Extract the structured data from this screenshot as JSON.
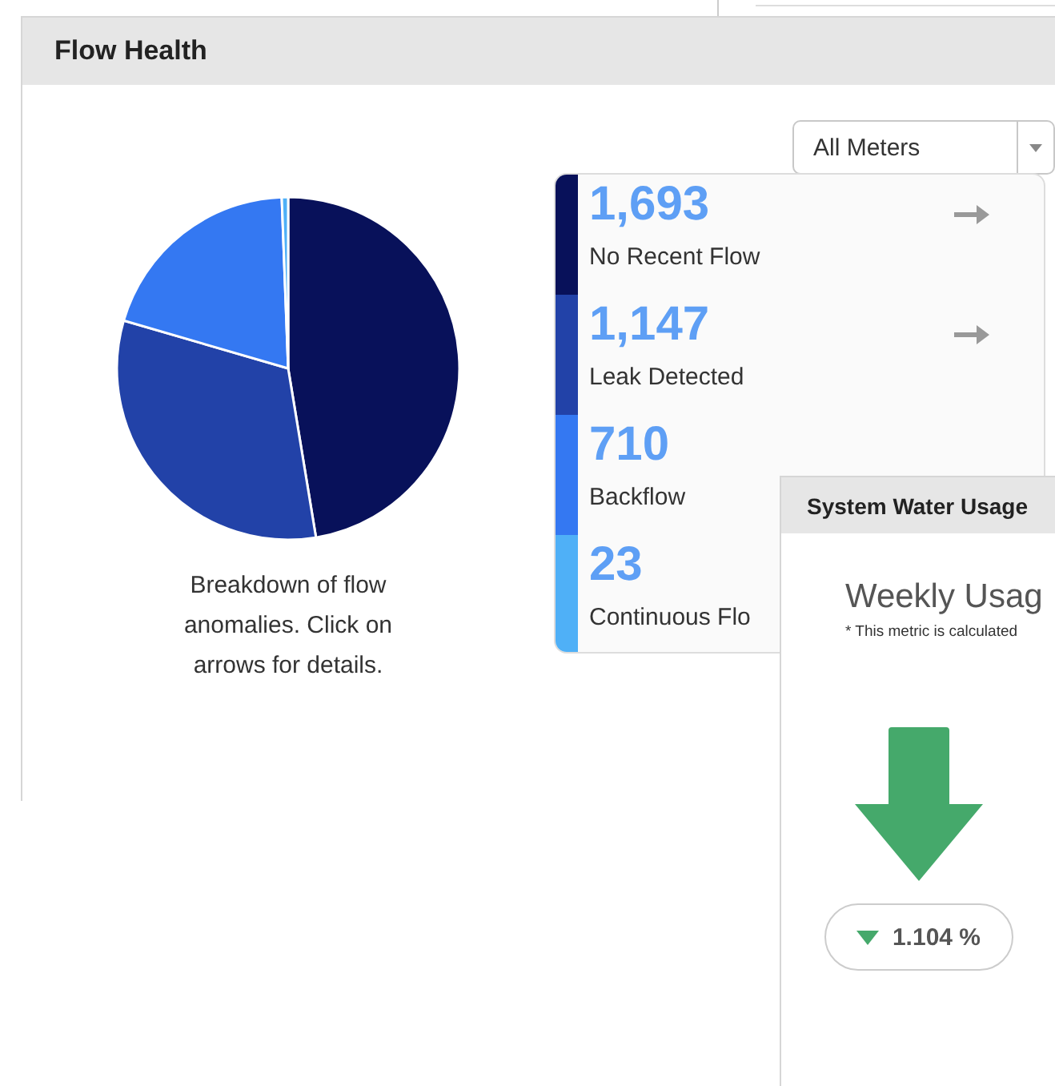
{
  "flow_health": {
    "title": "Flow Health",
    "meter_filter": {
      "value": "All Meters"
    },
    "chart_data": {
      "type": "pie",
      "values": [
        47.4,
        32.1,
        19.9,
        0.6
      ]
    },
    "caption": "Breakdown of flow anomalies. Click on arrows for details.",
    "stats": [
      {
        "count": "1,693",
        "label": "No Recent Flow",
        "color": "#08115a",
        "arrow": true
      },
      {
        "count": "1,147",
        "label": "Leak Detected",
        "color": "#2242a8",
        "arrow": true
      },
      {
        "count": "710",
        "label": "Backflow",
        "color": "#3478f2"
      },
      {
        "count": "23",
        "label": "Continuous Flo",
        "color": "#4fb0f7"
      }
    ]
  },
  "system_water_usage": {
    "title": "System Water Usage",
    "heading": "Weekly Usag",
    "footnote": "* This metric is calculated",
    "change": "1.104 %"
  }
}
